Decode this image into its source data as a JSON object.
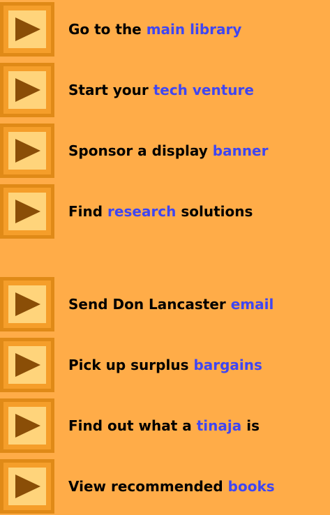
{
  "colors": {
    "background": "#FFAC48",
    "link": "#3F46F2",
    "text": "#000000",
    "button_face": "#FFD47B",
    "button_border": "#E08A17",
    "arrow": "#8A4E07"
  },
  "items": [
    {
      "icon": "play-arrow-icon",
      "prefix": "Go to the ",
      "link": "main library",
      "suffix": ""
    },
    {
      "icon": "play-arrow-icon",
      "prefix": "Start your ",
      "link": "tech venture",
      "suffix": ""
    },
    {
      "icon": "play-arrow-icon",
      "prefix": "Sponsor a display ",
      "link": "banner",
      "suffix": ""
    },
    {
      "icon": "play-arrow-icon",
      "prefix": "Find ",
      "link": "research",
      "suffix": " solutions"
    },
    {
      "icon": "play-arrow-icon",
      "prefix": "Send Don Lancaster ",
      "link": "email",
      "suffix": ""
    },
    {
      "icon": "play-arrow-icon",
      "prefix": "Pick up surplus ",
      "link": "bargains",
      "suffix": ""
    },
    {
      "icon": "play-arrow-icon",
      "prefix": "Find out what a ",
      "link": "tinaja",
      "suffix": " is"
    },
    {
      "icon": "play-arrow-icon",
      "prefix": "View recommended ",
      "link": "books",
      "suffix": ""
    }
  ]
}
